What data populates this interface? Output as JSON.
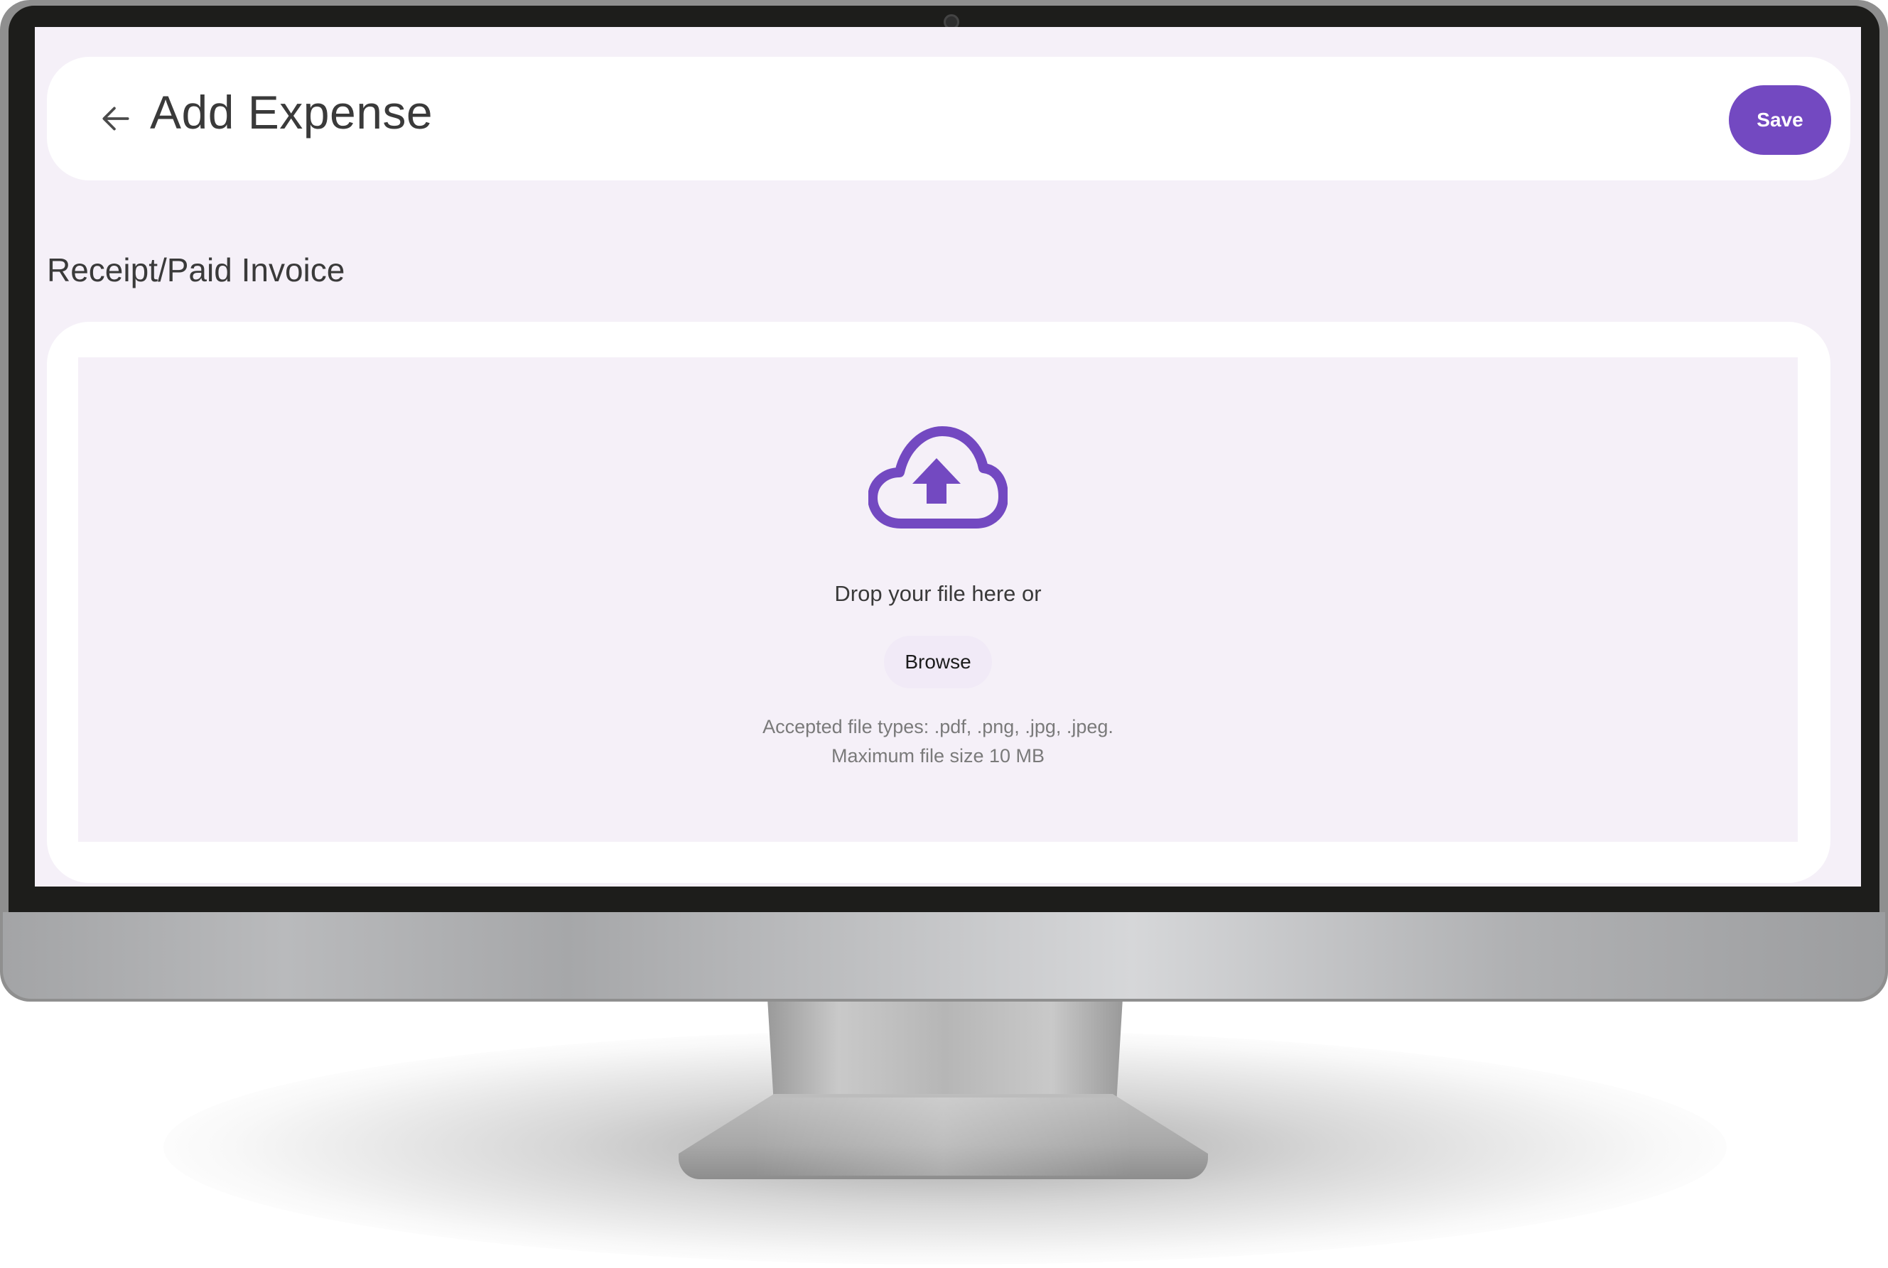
{
  "header": {
    "title": "Add Expense",
    "back_icon": "arrow-left-icon",
    "save_label": "Save"
  },
  "section": {
    "title": "Receipt/Paid Invoice"
  },
  "upload": {
    "icon": "cloud-upload-icon",
    "prompt": "Drop your file here or",
    "browse_label": "Browse",
    "accepted_types": "Accepted file types: .pdf, .png, .jpg, .jpeg.",
    "max_size": "Maximum file size 10 MB"
  },
  "colors": {
    "accent": "#7349c1",
    "screen_background": "#f5f0f8",
    "card_background": "#ffffff"
  }
}
